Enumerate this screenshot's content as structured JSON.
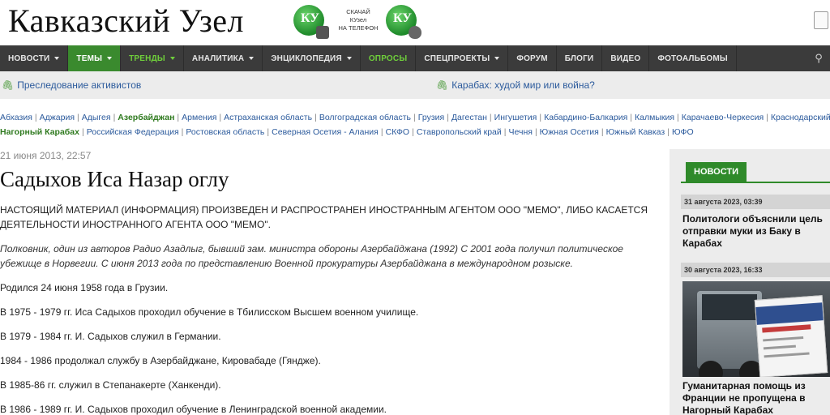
{
  "header": {
    "logo": "Кавказский Узел",
    "app_badge_text": "КУ",
    "app_promo": [
      "СКАЧАЙ",
      "КУзел",
      "НА ТЕЛЕФОН"
    ]
  },
  "nav": {
    "items": [
      {
        "label": "НОВОСТИ",
        "caret": true,
        "style": "normal"
      },
      {
        "label": "ТЕМЫ",
        "caret": true,
        "style": "active"
      },
      {
        "label": "ТРЕНДЫ",
        "caret": true,
        "style": "green"
      },
      {
        "label": "АНАЛИТИКА",
        "caret": true,
        "style": "normal"
      },
      {
        "label": "ЭНЦИКЛОПЕДИЯ",
        "caret": true,
        "style": "normal"
      },
      {
        "label": "ОПРОСЫ",
        "caret": false,
        "style": "green"
      },
      {
        "label": "ОПРОСЫ",
        "caret": false,
        "style": "green"
      },
      {
        "label": "СПЕЦПРОЕКТЫ",
        "caret": true,
        "style": "normal"
      },
      {
        "label": "ФОРУМ",
        "caret": false,
        "style": "normal"
      },
      {
        "label": "БЛОГИ",
        "caret": false,
        "style": "normal"
      },
      {
        "label": "ВИДЕО",
        "caret": false,
        "style": "normal"
      },
      {
        "label": "ФОТОАЛЬБОМЫ",
        "caret": false,
        "style": "normal"
      }
    ]
  },
  "topics": {
    "left": "Преследование активистов",
    "right": "Карабах: худой мир или война?"
  },
  "regions": {
    "row1": [
      "Абхазия",
      "Аджария",
      "Адыгея",
      "Азербайджан",
      "Армения",
      "Астраханская область",
      "Волгоградская область",
      "Грузия",
      "Дагестан",
      "Ингушетия",
      "Кабардино-Балкария",
      "Калмыкия",
      "Карачаево-Черкесия",
      "Краснодарский"
    ],
    "row2": [
      "Нагорный Карабах",
      "Российская Федерация",
      "Ростовская область",
      "Северная Осетия - Алания",
      "СКФО",
      "Ставропольский край",
      "Чечня",
      "Южная Осетия",
      "Южный Кавказ",
      "ЮФО"
    ],
    "active": [
      "Азербайджан",
      "Нагорный Карабах"
    ]
  },
  "article": {
    "date": "21 июня 2013, 22:57",
    "title": "Садыхов Иса Назар оглу",
    "notice": "НАСТОЯЩИЙ МАТЕРИАЛ (ИНФОРМАЦИЯ) ПРОИЗВЕДЕН И РАСПРОСТРАНЕН ИНОСТРАННЫМ АГЕНТОМ ООО \"МЕМО\", ЛИБО КАСАЕТСЯ ДЕЯТЕЛЬНОСТИ ИНОСТРАННОГО АГЕНТА ООО \"МЕМО\".",
    "lead": "Полковник, один из авторов Радио Азадлыг, бывший зам. министра обороны Азербайджана (1992) С  2001 года получил политическое убежище в Норвегии. С июня 2013 года по представлению Военной прокуратуры Азербайджана в международном розыске.",
    "paragraphs": [
      "Родился 24 июня 1958 года в Грузии.",
      "В 1975 - 1979 гг. Иса Садыхов проходил обучение в Тбилисском Высшем военном училище.",
      "В 1979 - 1984 гг. И. Садыхов служил в Германии.",
      "1984 - 1986 продолжал службу в Азербайджане, Кировабаде (Гяндже).",
      "В 1985-86 гг. служил в Степанакерте (Ханкенди).",
      "В 1986 - 1989 гг. И. Садыхов проходил обучение в Ленинградской военной академии."
    ]
  },
  "sidebar": {
    "tab": "НОВОСТИ",
    "news": [
      {
        "date": "31 августа 2023, 03:39",
        "title": "Политологи объяснили цель отправки муки из Баку в Карабах"
      },
      {
        "date": "30 августа 2023, 16:33",
        "title": "Гуманитарная помощь из Франции не пропущена в Нагорный Карабах"
      }
    ]
  }
}
